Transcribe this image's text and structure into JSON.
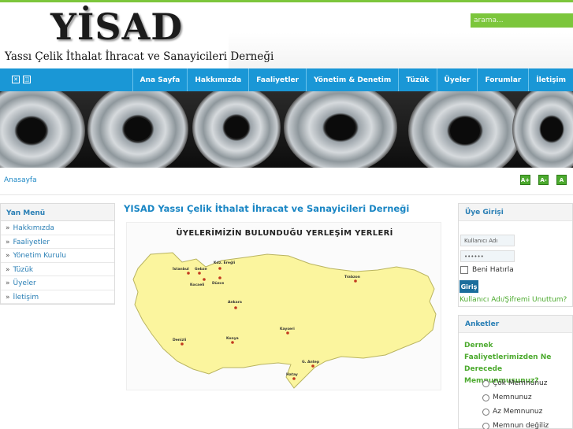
{
  "header": {
    "logo": "YİSAD",
    "subtitle": "Yassı Çelik İthalat İhracat ve Sanayicileri Derneği",
    "search_placeholder": "arama..."
  },
  "nav": {
    "items": [
      {
        "label": "Ana Sayfa"
      },
      {
        "label": "Hakkımızda"
      },
      {
        "label": "Faaliyetler"
      },
      {
        "label": "Yönetim & Denetim"
      },
      {
        "label": "Tüzük"
      },
      {
        "label": "Üyeler"
      },
      {
        "label": "Forumlar"
      },
      {
        "label": "İletişim"
      }
    ]
  },
  "breadcrumb": {
    "current": "Anasayfa"
  },
  "font_buttons": [
    "A+",
    "A-",
    "A"
  ],
  "left_menu": {
    "title": "Yan Menü",
    "items": [
      {
        "label": "Hakkımızda"
      },
      {
        "label": "Faaliyetler"
      },
      {
        "label": "Yönetim Kurulu"
      },
      {
        "label": "Tüzük"
      },
      {
        "label": "Üyeler"
      },
      {
        "label": "İletişim"
      }
    ]
  },
  "main": {
    "title": "YISAD Yassı Çelik İthalat İhracat ve Sanayicileri Derneği",
    "map_title": "ÜYELERİMİZİN BULUNDUĞU YERLEŞİM YERLERİ",
    "cities": [
      "İstanbul",
      "Gebze",
      "Kocaeli",
      "Kdz. Ereğli",
      "Düzce",
      "Trabzon",
      "Ankara",
      "Kayseri",
      "Konya",
      "Denizli",
      "G. Antep",
      "Hatay"
    ]
  },
  "login": {
    "title": "Üye Girişi",
    "username_placeholder": "Kullanıcı Adı",
    "password_value": "••••••",
    "remember_label": "Beni Hatırla",
    "button_label": "Giriş",
    "forgot_link": "Kullanıcı Adı/Şifremi Unuttum?"
  },
  "poll": {
    "title": "Anketler",
    "question": "Dernek Faaliyetlerimizden Ne Derecede Memnunmusunuz?",
    "options": [
      {
        "label": "Çok Memnunuz"
      },
      {
        "label": "Memnunuz"
      },
      {
        "label": "Az Memnunuz"
      },
      {
        "label": "Memnun değiliz"
      }
    ]
  },
  "colors": {
    "nav_blue": "#1a97d6",
    "accent_green": "#7cc63c",
    "link_blue": "#1a86c4",
    "map_fill": "#fbf59e"
  }
}
